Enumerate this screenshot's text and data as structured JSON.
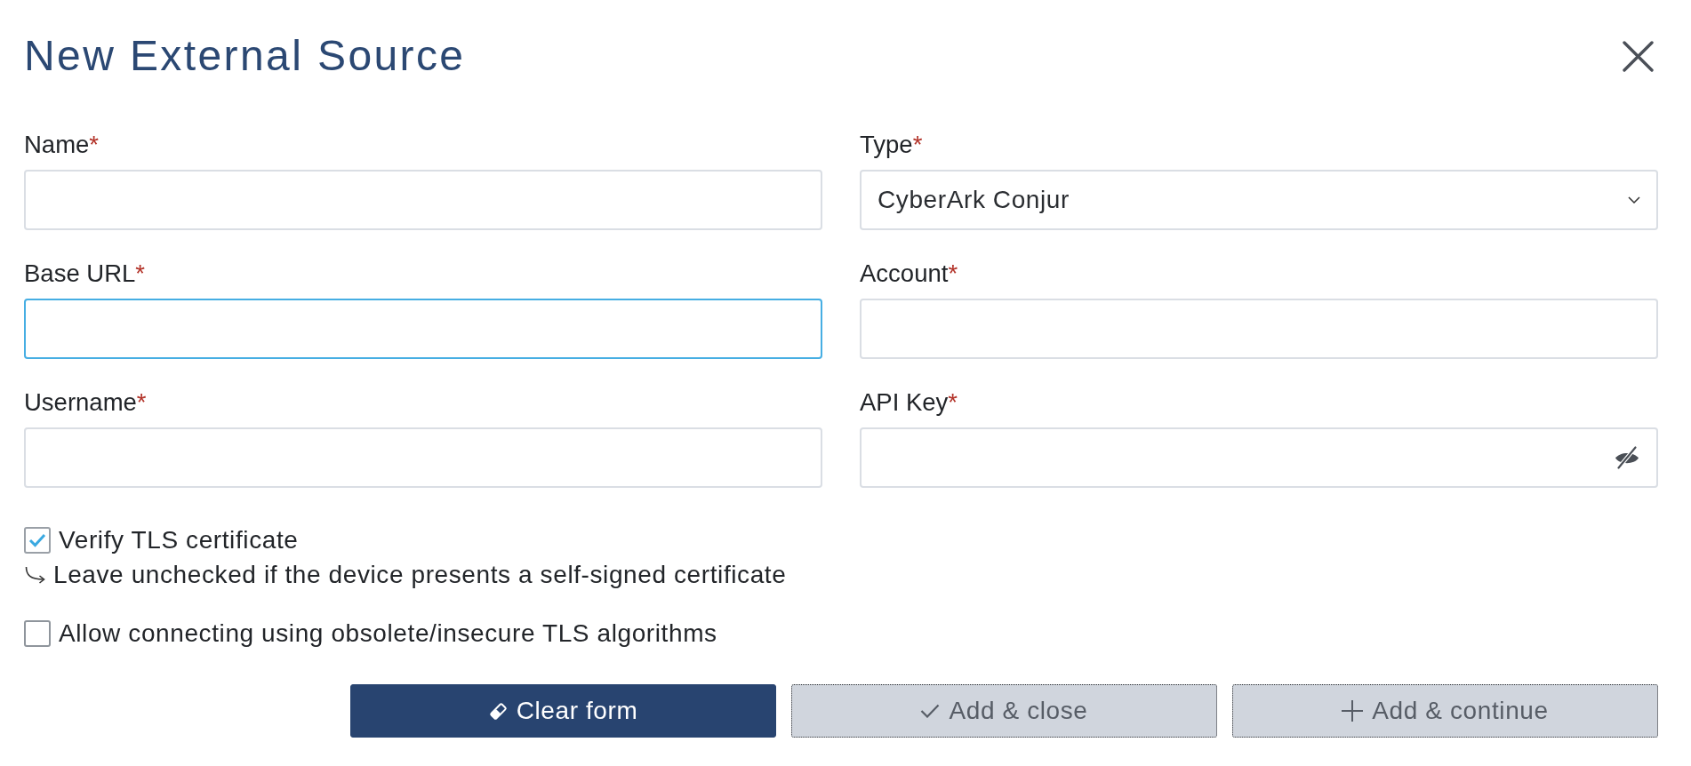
{
  "dialog": {
    "title": "New External Source"
  },
  "fields": [
    {
      "label": "Name",
      "required_marker": "*",
      "kind": "text",
      "focused": false
    },
    {
      "label": "Type",
      "required_marker": "*",
      "kind": "select",
      "value": "CyberArk Conjur",
      "focused": false
    },
    {
      "label": "Base URL",
      "required_marker": "*",
      "kind": "text",
      "focused": true
    },
    {
      "label": "Account",
      "required_marker": "*",
      "kind": "text",
      "focused": false
    },
    {
      "label": "Username",
      "required_marker": "*",
      "kind": "text",
      "focused": false
    },
    {
      "label": "API Key",
      "required_marker": "*",
      "kind": "password",
      "focused": false
    }
  ],
  "options": [
    {
      "label": "Verify TLS certificate",
      "checked": true,
      "hint": "Leave unchecked if the device presents a self-signed certificate"
    },
    {
      "label": "Allow connecting using obsolete/insecure TLS algorithms",
      "checked": false
    }
  ],
  "buttons": [
    {
      "label": "Clear form",
      "kind": "clear",
      "disabled": false
    },
    {
      "label": "Add & close",
      "kind": "confirm",
      "disabled": true
    },
    {
      "label": "Add & continue",
      "kind": "add",
      "disabled": true
    }
  ]
}
